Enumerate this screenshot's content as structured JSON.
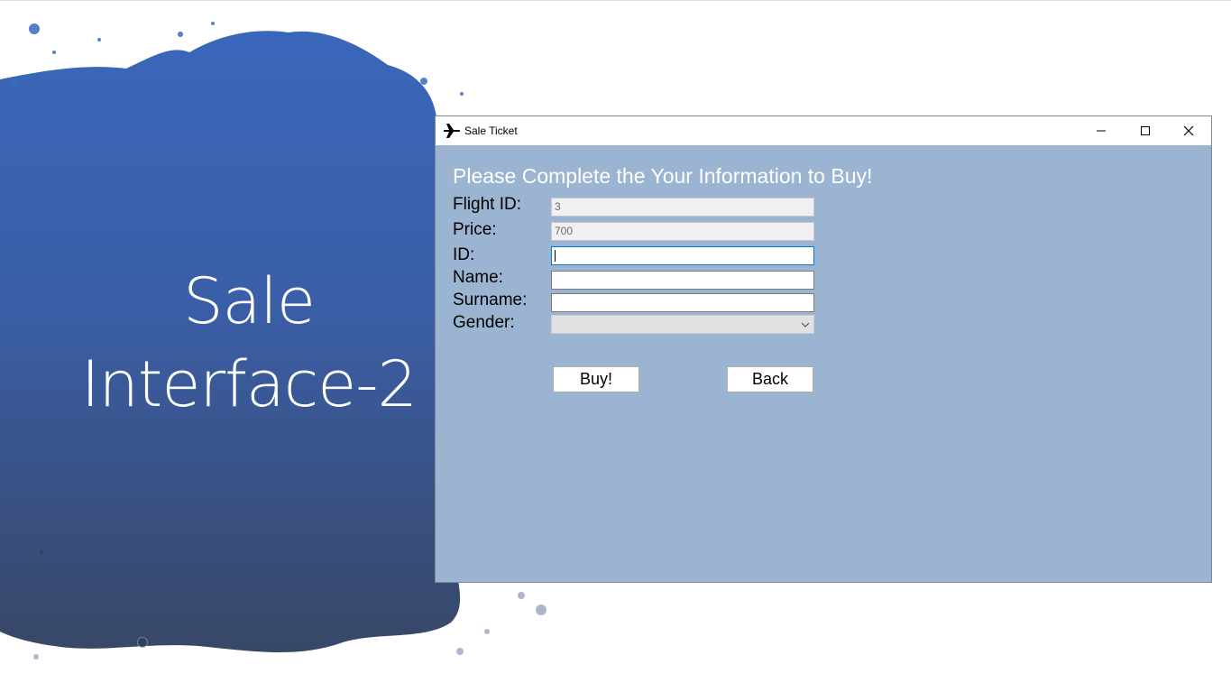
{
  "slide": {
    "title_line1": "Sale",
    "title_line2": "Interface-2"
  },
  "window": {
    "title": "Sale Ticket",
    "app_icon": "airplane-icon",
    "controls": [
      "minimize-icon",
      "maximize-icon",
      "close-icon"
    ]
  },
  "form": {
    "heading": "Please Complete the Your Information to Buy!",
    "flight_id_label": "Flight ID:",
    "flight_id_value": "3",
    "price_label": "Price:",
    "price_value": "700",
    "id_label": "ID:",
    "id_value": "",
    "name_label": "Name:",
    "name_value": "",
    "surname_label": "Surname:",
    "surname_value": "",
    "gender_label": "Gender:",
    "gender_value": "",
    "buy_label": "Buy!",
    "back_label": "Back"
  },
  "colors": {
    "form_background": "#9ab4d1",
    "splash_top": "#3a66b6",
    "splash_bottom": "#394a6a",
    "focus_border": "#0078d7"
  }
}
